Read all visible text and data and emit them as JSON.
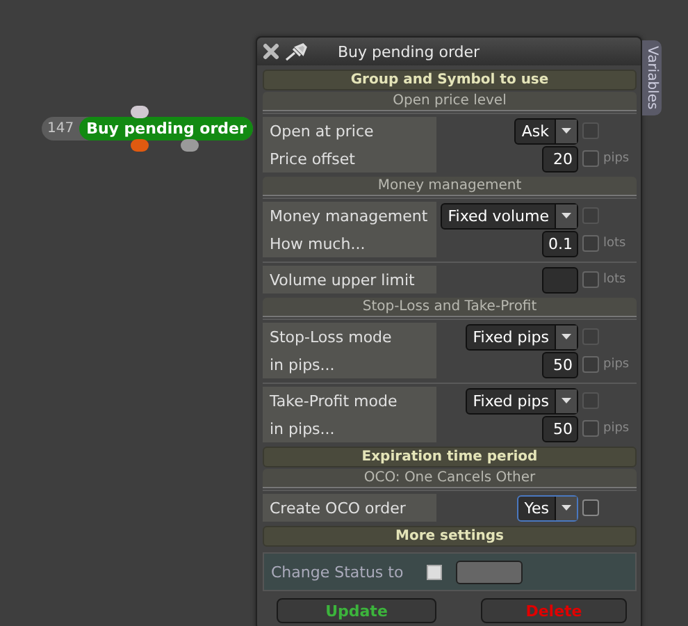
{
  "node": {
    "number": "147",
    "label": "Buy pending order"
  },
  "panel": {
    "title": "Buy pending order",
    "side_tab": "Variables",
    "sections": [
      {
        "kind": "header",
        "text": "Group and Symbol to use"
      },
      {
        "kind": "subheader",
        "text": "Open price level"
      },
      {
        "kind": "group",
        "rows": [
          {
            "kind": "select",
            "label": "Open at price",
            "value": "Ask",
            "focused": false,
            "checked": false
          },
          {
            "kind": "number",
            "label": "Price offset",
            "value": "20",
            "unit": "pips",
            "checked": false
          }
        ]
      },
      {
        "kind": "subheader",
        "text": "Money management"
      },
      {
        "kind": "group",
        "rows": [
          {
            "kind": "select",
            "label": "Money management",
            "value": "Fixed volume",
            "focused": false,
            "checked": false
          },
          {
            "kind": "number",
            "label": "How much...",
            "value": "0.1",
            "unit": "lots",
            "checked": false
          }
        ]
      },
      {
        "kind": "group",
        "rows": [
          {
            "kind": "number",
            "label": "Volume upper limit",
            "unit": "lots",
            "checked": false
          }
        ]
      },
      {
        "kind": "subheader",
        "text": "Stop-Loss and Take-Profit"
      },
      {
        "kind": "group",
        "rows": [
          {
            "kind": "select",
            "label": "Stop-Loss mode",
            "value": "Fixed pips",
            "focused": false,
            "checked": false
          },
          {
            "kind": "number",
            "label": "in pips...",
            "value": "50",
            "unit": "pips",
            "checked": false
          }
        ]
      },
      {
        "kind": "group",
        "rows": [
          {
            "kind": "select",
            "label": "Take-Profit mode",
            "value": "Fixed pips",
            "focused": false,
            "checked": false
          },
          {
            "kind": "number",
            "label": "in pips...",
            "value": "50",
            "unit": "pips",
            "checked": false
          }
        ]
      },
      {
        "kind": "header",
        "text": "Expiration time period"
      },
      {
        "kind": "subheader",
        "text": "OCO: One Cancels Other"
      },
      {
        "kind": "group",
        "rows": [
          {
            "kind": "select",
            "label": "Create OCO order",
            "value": "Yes",
            "focused": true,
            "checked": false
          }
        ]
      },
      {
        "kind": "header",
        "text": "More settings"
      },
      {
        "kind": "status",
        "label": "Change Status to",
        "checked": false
      }
    ],
    "buttons": [
      {
        "kind": "update",
        "label": "Update"
      },
      {
        "kind": "delete",
        "label": "Delete"
      }
    ]
  }
}
